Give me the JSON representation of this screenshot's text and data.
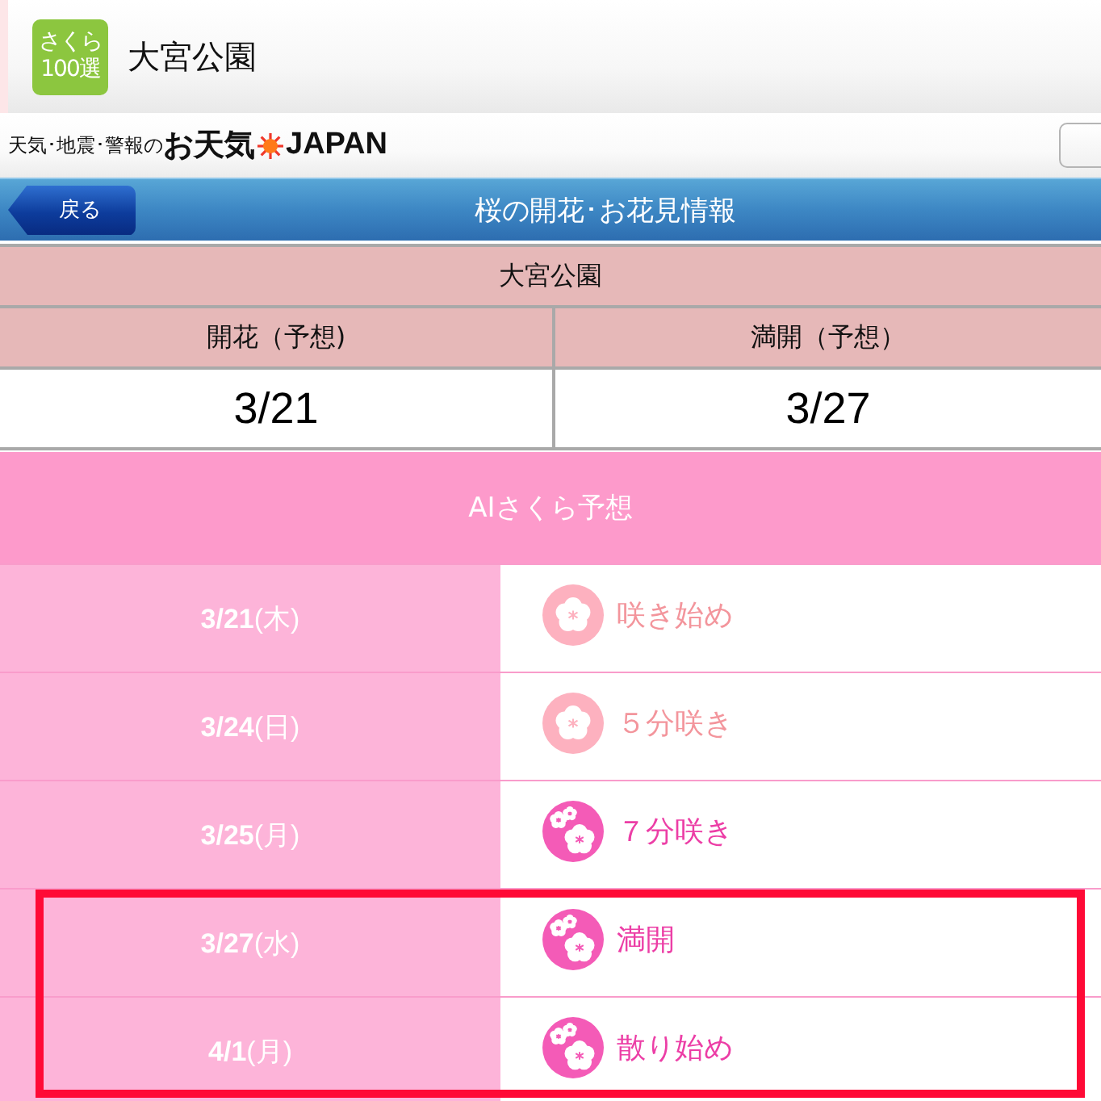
{
  "header": {
    "logo": {
      "line_1": "さくら",
      "line_2": "100選"
    },
    "title": "大宮公園"
  },
  "brand_bar": {
    "tagline": "天気･地震･警報の",
    "brand_name": "お天気",
    "brand_suffix": "JAPAN"
  },
  "nav_bar": {
    "back_button": "戻る",
    "title": "桜の開花･お花見情報"
  },
  "summary_table": {
    "title": "大宮公園",
    "columns": [
      {
        "heading": "開花（予想)",
        "value": "3/21"
      },
      {
        "heading": "満開（予想）",
        "value": "3/27"
      }
    ]
  },
  "forecast": {
    "title": "AIさくら予想",
    "rows": [
      {
        "date": "**3/21**(木)",
        "status": "咲き始め",
        "kind": "partial",
        "highlighted": false
      },
      {
        "date": "**3/24**(日)",
        "status": "５分咲き",
        "kind": "partial",
        "highlighted": false
      },
      {
        "date": "**3/25**(月)",
        "status": "７分咲き",
        "kind": "full",
        "highlighted": false
      },
      {
        "date": "**3/27**(水)",
        "status": "満開",
        "kind": "full",
        "highlighted": true
      },
      {
        "date": "**4/1**(月)",
        "status": "散り始め",
        "kind": "full",
        "highlighted": true
      }
    ]
  }
}
